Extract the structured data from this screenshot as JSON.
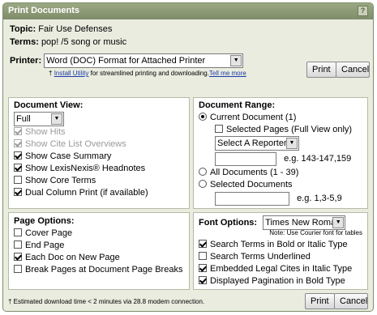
{
  "window": {
    "title": "Print Documents",
    "help_label": "?"
  },
  "topic": {
    "label": "Topic:",
    "value": "Fair Use Defenses"
  },
  "terms": {
    "label": "Terms:",
    "value": "pop! /5 song or music"
  },
  "printer": {
    "label": "Printer:",
    "selected": "Word (DOC) Format for Attached Printer",
    "utility_prefix": "†",
    "utility_link": "Install Utility",
    "utility_text": " for streamlined printing and downloading.",
    "tell_more_link": "Tell me more",
    "print_label": "Print",
    "cancel_label": "Cancel"
  },
  "document_view": {
    "title": "Document View:",
    "selected": "Full",
    "options": [
      {
        "label": "Show Hits",
        "checked": true,
        "disabled": true
      },
      {
        "label": "Show Cite List Overviews",
        "checked": true,
        "disabled": true
      },
      {
        "label": "Show Case Summary",
        "checked": true,
        "disabled": false
      },
      {
        "label": "Show LexisNexis® Headnotes",
        "checked": true,
        "disabled": false
      },
      {
        "label": "Show Core Terms",
        "checked": false,
        "disabled": false
      },
      {
        "label": "Dual Column Print (if available)",
        "checked": true,
        "disabled": false
      }
    ]
  },
  "document_range": {
    "title": "Document Range:",
    "current": "Current Document (1)",
    "selected_pages": "Selected Pages (Full View only)",
    "reporter_select": "Select A Reporter",
    "pages_example": "e.g. 143-147,159",
    "all_docs": "All Documents (1 - 39)",
    "selected_docs": "Selected Documents",
    "docs_example": "e.g. 1,3-5,9"
  },
  "page_options": {
    "title": "Page Options:",
    "options": [
      {
        "label": "Cover Page",
        "checked": false
      },
      {
        "label": "End Page",
        "checked": false
      },
      {
        "label": "Each Doc on New Page",
        "checked": true
      },
      {
        "label": "Break Pages at Document Page Breaks",
        "checked": false
      }
    ]
  },
  "font_options": {
    "title": "Font Options:",
    "selected": "Times New Roman",
    "note": "Note: Use Courier font for tables",
    "options": [
      {
        "label": "Search Terms in Bold or Italic Type",
        "checked": true
      },
      {
        "label": "Search Terms Underlined",
        "checked": false
      },
      {
        "label": "Embedded Legal Cites in Italic Type",
        "checked": true
      },
      {
        "label": "Displayed Pagination in Bold Type",
        "checked": true
      }
    ]
  },
  "footer": {
    "estimate": "† Estimated download time < 2 minutes via 28.8 modem connection.",
    "print_label": "Print",
    "cancel_label": "Cancel"
  }
}
